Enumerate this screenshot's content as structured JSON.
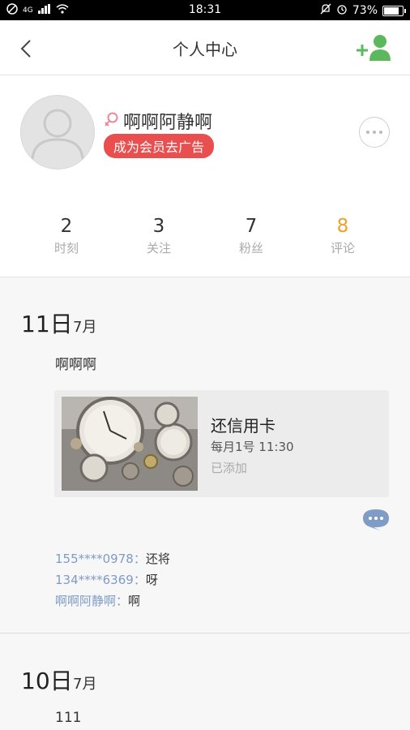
{
  "status_bar": {
    "time": "18:31",
    "battery": "73%",
    "network": "4G"
  },
  "nav": {
    "title": "个人中心"
  },
  "profile": {
    "username": "啊啊阿静啊",
    "vip_badge": "成为会员去广告",
    "stats": [
      {
        "value": "2",
        "label": "时刻"
      },
      {
        "value": "3",
        "label": "关注"
      },
      {
        "value": "7",
        "label": "粉丝"
      },
      {
        "value": "8",
        "label": "评论"
      }
    ]
  },
  "timeline": [
    {
      "day": "11日",
      "month": "7月",
      "text": "啊啊啊",
      "card": {
        "title": "还信用卡",
        "schedule": "每月1号 11:30",
        "status": "已添加"
      },
      "comments": [
        {
          "user": "155****0978",
          "sep": "：",
          "text": "还将"
        },
        {
          "user": "134****6369",
          "sep": "：",
          "text": "呀"
        },
        {
          "user": "啊啊阿静啊",
          "sep": "：",
          "text": "啊"
        }
      ]
    },
    {
      "day": "10日",
      "month": "7月",
      "text": "111"
    }
  ],
  "colors": {
    "accent_green": "#5cb85c",
    "badge_red": "#e94f4f",
    "highlight_orange": "#f0a024",
    "link_blue": "#7f9bc6"
  }
}
